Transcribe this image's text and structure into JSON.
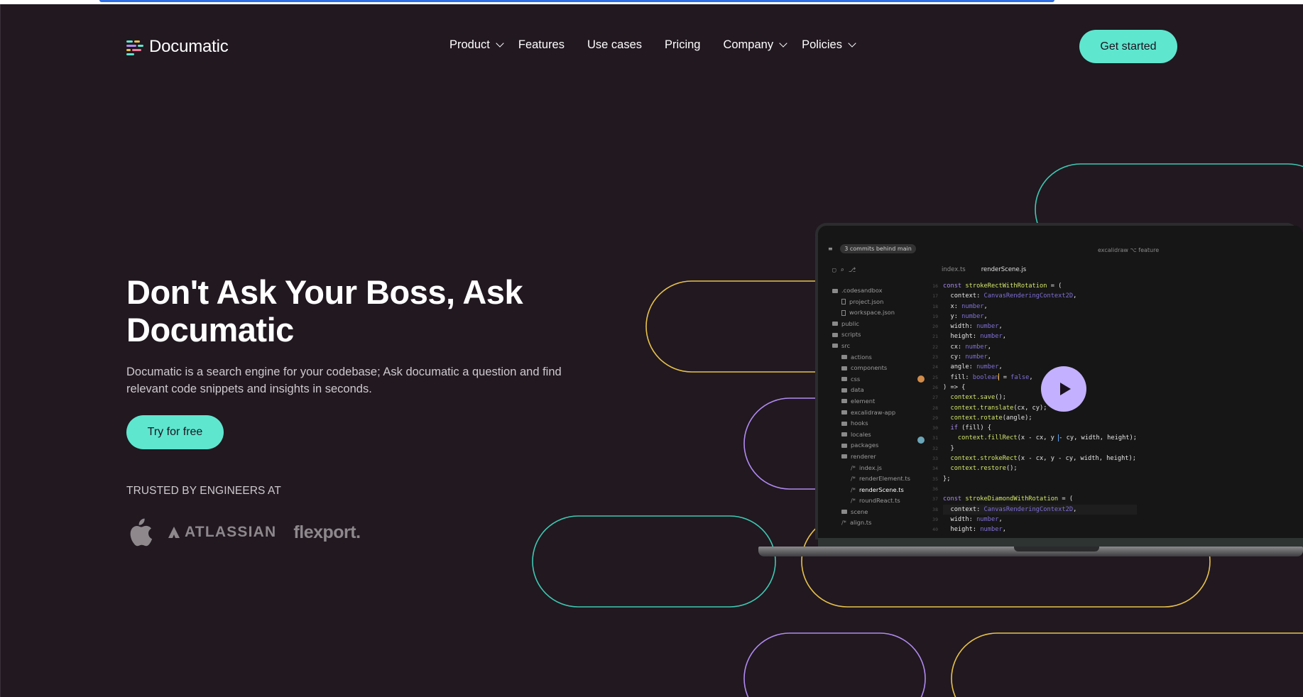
{
  "colors": {
    "background": "#211820",
    "accent": "#5fe6cf",
    "play_button": "#c3b0ff",
    "decor_teal": "#3ec9b3",
    "decor_yellow": "#e8c24a",
    "decor_purple": "#b18af0",
    "muted_text": "#cfc9ce",
    "loading_bar": "#2f6fe6"
  },
  "brand": {
    "name": "Documatic"
  },
  "nav": {
    "items": [
      {
        "label": "Product",
        "dropdown": true
      },
      {
        "label": "Features",
        "dropdown": false
      },
      {
        "label": "Use cases",
        "dropdown": false
      },
      {
        "label": "Pricing",
        "dropdown": false
      },
      {
        "label": "Company",
        "dropdown": true
      },
      {
        "label": "Policies",
        "dropdown": true
      }
    ],
    "cta_label": "Get started"
  },
  "hero": {
    "title": "Don't Ask Your Boss, Ask Documatic",
    "subtitle": "Documatic is a search engine for your codebase; Ask documatic a question and find relevant code snippets and insights in seconds.",
    "cta_label": "Try for free",
    "trusted_label": "TRUSTED BY ENGINEERS AT",
    "logos": [
      {
        "name": "Apple",
        "icon": "apple-logo"
      },
      {
        "name": "ATLASSIAN",
        "icon": "atlassian-logo"
      },
      {
        "name": "flexport.",
        "icon": "flexport-logo"
      }
    ]
  },
  "editor": {
    "commits_badge": "3 commits behind main",
    "repo": "excalidraw",
    "branch": "feature",
    "tabs": [
      "index.ts",
      "renderScene.js"
    ],
    "active_tab": 1,
    "tree": [
      {
        "label": ".codesandbox",
        "kind": "folder",
        "depth": 0
      },
      {
        "label": "project.json",
        "kind": "file",
        "depth": 1
      },
      {
        "label": "workspace.json",
        "kind": "file",
        "depth": 1
      },
      {
        "label": "public",
        "kind": "folder",
        "depth": 0
      },
      {
        "label": "scripts",
        "kind": "folder",
        "depth": 0
      },
      {
        "label": "src",
        "kind": "folder",
        "depth": 0
      },
      {
        "label": "actions",
        "kind": "folder",
        "depth": 1
      },
      {
        "label": "components",
        "kind": "folder",
        "depth": 1
      },
      {
        "label": "css",
        "kind": "folder",
        "depth": 1
      },
      {
        "label": "data",
        "kind": "folder",
        "depth": 1
      },
      {
        "label": "element",
        "kind": "folder",
        "depth": 1
      },
      {
        "label": "excalidraw-app",
        "kind": "folder",
        "depth": 1
      },
      {
        "label": "hooks",
        "kind": "folder",
        "depth": 1
      },
      {
        "label": "locales",
        "kind": "folder",
        "depth": 1
      },
      {
        "label": "packages",
        "kind": "folder",
        "depth": 1
      },
      {
        "label": "renderer",
        "kind": "folder",
        "depth": 1
      },
      {
        "label": "index.js",
        "kind": "ts",
        "depth": 2
      },
      {
        "label": "renderElement.ts",
        "kind": "ts",
        "depth": 2
      },
      {
        "label": "renderScene.ts",
        "kind": "ts",
        "depth": 2,
        "selected": true
      },
      {
        "label": "roundReact.ts",
        "kind": "ts",
        "depth": 2
      },
      {
        "label": "scene",
        "kind": "folder",
        "depth": 1
      },
      {
        "label": "align.ts",
        "kind": "ts",
        "depth": 1
      }
    ],
    "code": [
      "const strokeRectWithRotation = (",
      "  context: CanvasRenderingContext2D,",
      "  x: number,",
      "  y: number,",
      "  width: number,",
      "  height: number,",
      "  cx: number,",
      "  cy: number,",
      "  angle: number,",
      "  fill: boolean = false,",
      ") => {",
      "  context.save();",
      "  context.translate(cx, cy);",
      "  context.rotate(angle);",
      "  if (fill) {",
      "    context.fillRect(x - cx, y - cy, width, height);",
      "  }",
      "  context.strokeRect(x - cx, y - cy, width, height);",
      "  context.restore();",
      "};",
      "",
      "const strokeDiamondWithRotation = (",
      "  context: CanvasRenderingContext2D,",
      "  width: number,",
      "  height: number,"
    ],
    "line_numbers": [
      "16",
      "17",
      "18",
      "19",
      "20",
      "21",
      "22",
      "23",
      "24",
      "25",
      "26",
      "27",
      "28",
      "29",
      "30",
      "31",
      "32",
      "33",
      "34",
      "35",
      "36",
      "37",
      "38",
      "39",
      "40"
    ]
  }
}
